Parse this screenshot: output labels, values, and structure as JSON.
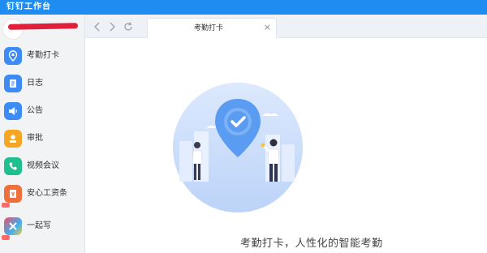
{
  "app": {
    "title": "钉钉工作台"
  },
  "sidebar": {
    "items": [
      {
        "label": "考勤打卡",
        "icon": "location-pin-icon",
        "color": "#3d8bf5"
      },
      {
        "label": "日志",
        "icon": "notebook-icon",
        "color": "#3d8bf5"
      },
      {
        "label": "公告",
        "icon": "megaphone-icon",
        "color": "#3d8bf5"
      },
      {
        "label": "审批",
        "icon": "person-stamp-icon",
        "color": "#f5a623"
      },
      {
        "label": "视频会议",
        "icon": "phone-icon",
        "color": "#1fbf8f"
      },
      {
        "label": "安心工资条",
        "icon": "salary-icon",
        "color": "#f0703c"
      },
      {
        "label": "一起写",
        "icon": "collab-doc-icon",
        "color": "#ef4f6a"
      }
    ]
  },
  "tab": {
    "label": "考勤打卡",
    "close": "×"
  },
  "main": {
    "slogan": "考勤打卡，人性化的智能考勤"
  },
  "colors": {
    "brand": "#1e8cf0",
    "sidebar_bg": "#f2f3f5"
  }
}
